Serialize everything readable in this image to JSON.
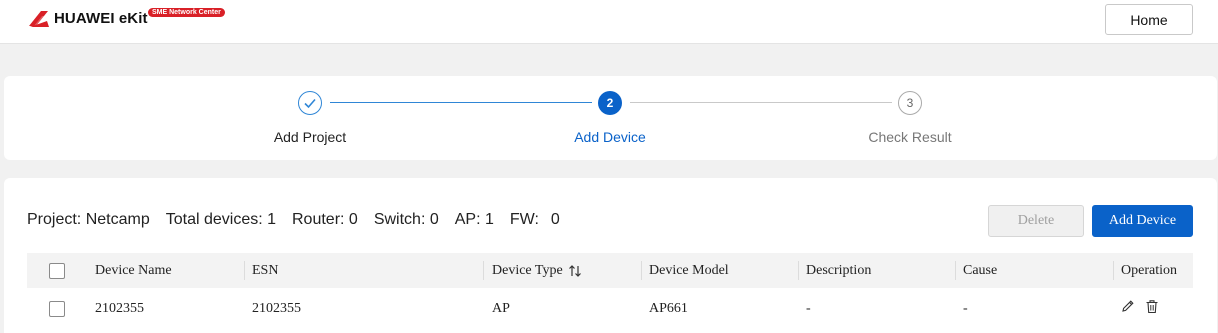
{
  "header": {
    "brand_name": "HUAWEI eKit",
    "brand_badge": "SME Network Center",
    "home_button": "Home",
    "brand_color": "#d92027"
  },
  "steps": {
    "items": [
      {
        "label": "Add Project",
        "state": "done"
      },
      {
        "label": "Add Device",
        "number": "2",
        "state": "active"
      },
      {
        "label": "Check Result",
        "number": "3",
        "state": "pending"
      }
    ],
    "accent_color": "#0a62c9"
  },
  "summary": {
    "project": "Project: Netcamp",
    "total": "Total devices: 1",
    "router": "Router: 0",
    "switch": "Switch: 0",
    "ap": "AP: 1",
    "fw": "FW:",
    "fw_value": "0"
  },
  "actions": {
    "delete_label": "Delete",
    "add_device_label": "Add Device"
  },
  "table": {
    "columns": {
      "device_name": "Device Name",
      "esn": "ESN",
      "device_type": "Device Type",
      "device_model": "Device Model",
      "description": "Description",
      "cause": "Cause",
      "operation": "Operation"
    },
    "rows": [
      {
        "device_name": "2102355",
        "esn": "2102355",
        "device_type": "AP",
        "device_model": "AP661",
        "description": "-",
        "cause": "-"
      }
    ],
    "icons": {
      "sort": "sort-icon",
      "edit": "edit-icon",
      "delete": "trash-icon"
    }
  }
}
